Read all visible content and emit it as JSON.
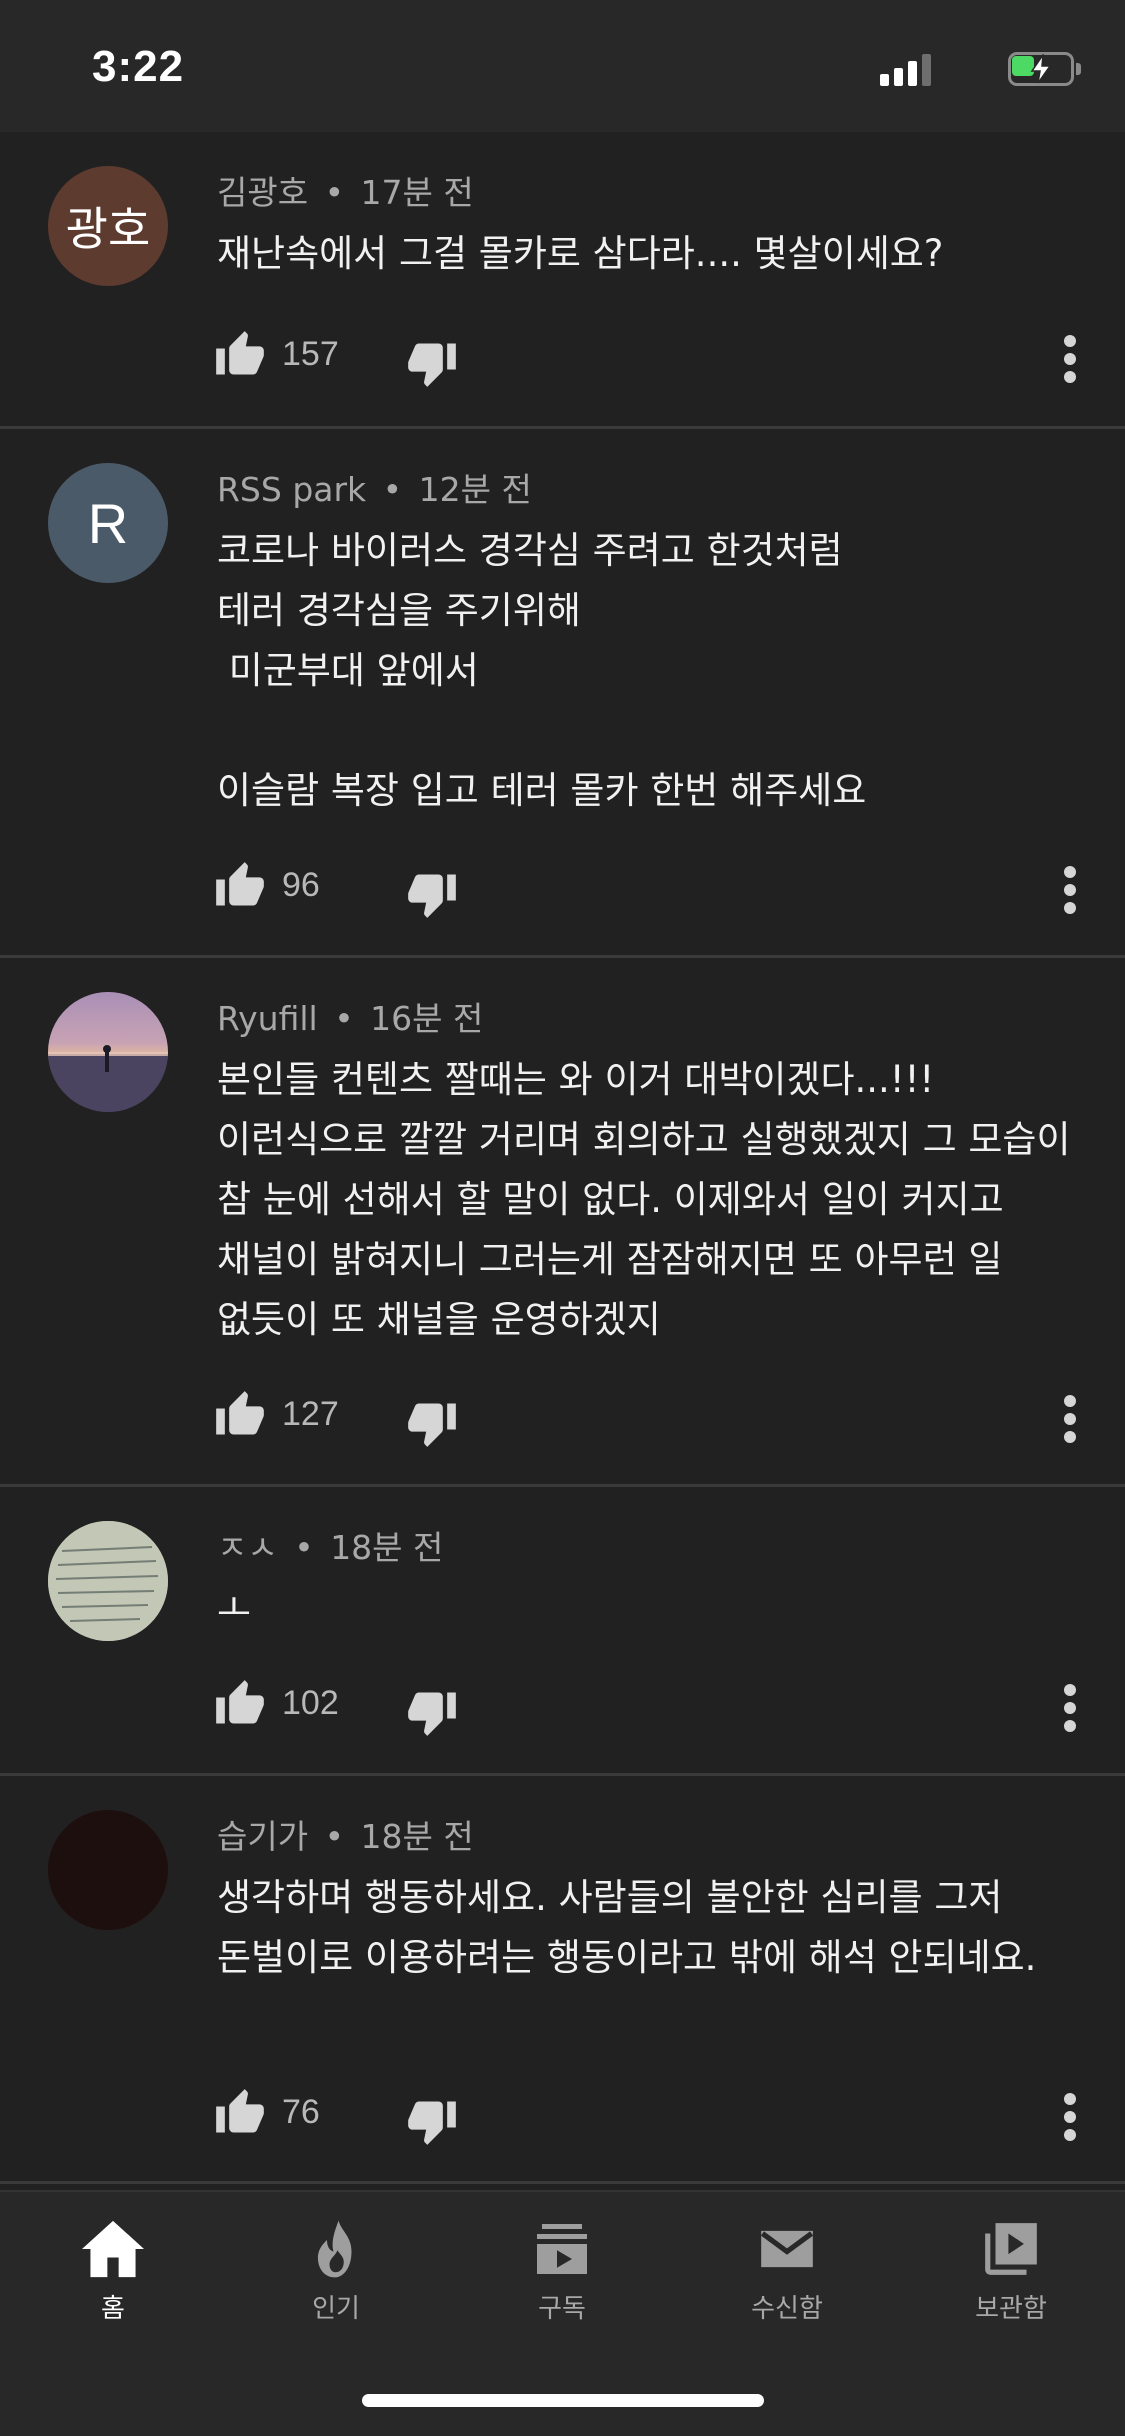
{
  "status_bar": {
    "time": "3:22",
    "signal_icon": "cellular-signal-icon",
    "battery_icon": "battery-charging-icon",
    "battery_color": "#4cd964"
  },
  "comments": [
    {
      "author": "김광호",
      "time": "17분 전",
      "avatar_text": "광호",
      "avatar_color": "#5e3b2f",
      "text": "재난속에서 그걸 몰카로 삼다라.... 몇살이세요?",
      "likes": "157"
    },
    {
      "author": "RSS park",
      "time": "12분 전",
      "avatar_text": "R",
      "avatar_color": "#4b5a68",
      "text": "코로나 바이러스 경각심 주려고 한것처럼\n테러 경각심을 주기위해\n 미군부대 앞에서\n\n이슬람 복장 입고 테러 몰카 한번 해주세요",
      "likes": "96"
    },
    {
      "author": "Ryufill",
      "time": "16분 전",
      "avatar_text": "",
      "avatar_color": "#7a6a8a",
      "text": "본인들 컨텐츠 짤때는 와 이거 대박이겠다...!!! 이런식으로 깔깔 거리며 회의하고 실행했겠지 그 모습이 참 눈에 선해서 할 말이 없다. 이제와서 일이 커지고 채널이 밝혀지니 그러는게 잠잠해지면 또 아무런 일 없듯이 또 채널을 운영하겠지",
      "likes": "127"
    },
    {
      "author": "ㅈㅅ",
      "time": "18분 전",
      "avatar_text": "",
      "avatar_color": "#b8bdb0",
      "text": "ㅗ",
      "likes": "102"
    },
    {
      "author": "습기가",
      "time": "18분 전",
      "avatar_text": "",
      "avatar_color": "#1e0f0f",
      "text": "생각하며 행동하세요. 사람들의 불안한 심리를 그저 돈벌이로 이용하려는 행동이라고 밖에 해석 안되네요.",
      "likes": "76"
    }
  ],
  "bottom_nav": [
    {
      "label": "홈",
      "icon": "home-icon",
      "active": true
    },
    {
      "label": "인기",
      "icon": "flame-icon",
      "active": false
    },
    {
      "label": "구독",
      "icon": "subscriptions-icon",
      "active": false
    },
    {
      "label": "수신함",
      "icon": "mail-icon",
      "active": false
    },
    {
      "label": "보관함",
      "icon": "library-icon",
      "active": false
    }
  ]
}
